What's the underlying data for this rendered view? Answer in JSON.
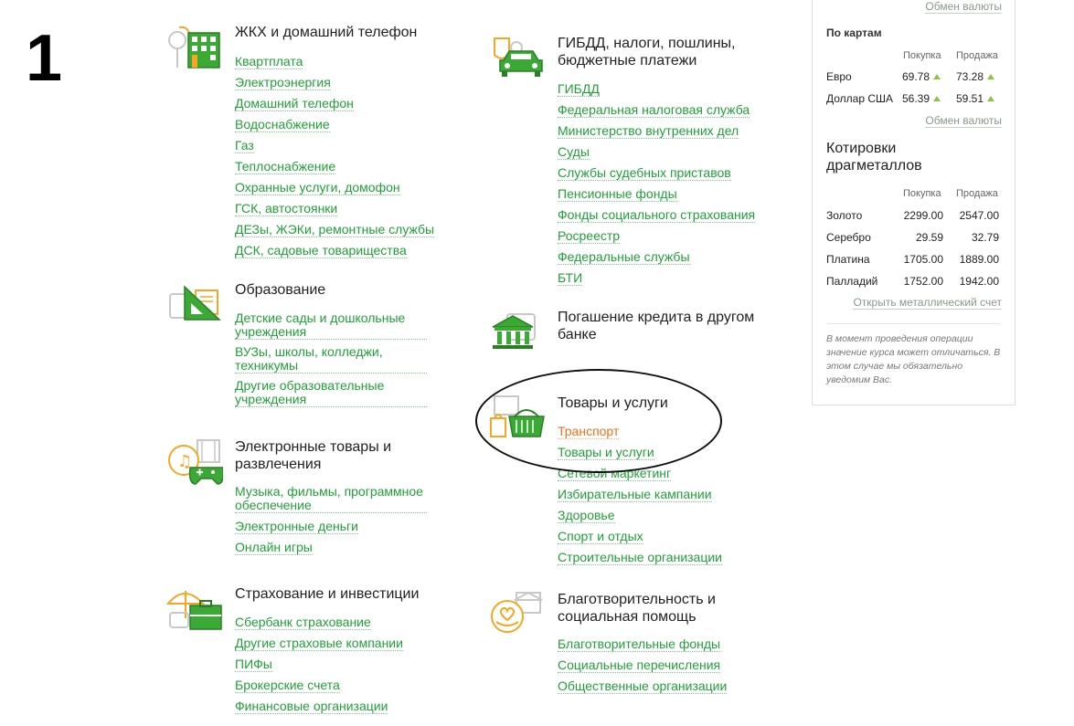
{
  "step_number": "1",
  "categories": {
    "zhkh": {
      "title": "ЖКХ и домашний телефон",
      "links": [
        "Квартплата",
        "Электроэнергия",
        "Домашний телефон",
        "Водоснабжение",
        "Газ",
        "Теплоснабжение",
        "Охранные услуги, домофон",
        "ГСК, автостоянки",
        "ДЕЗы, ЖЭКи, ремонтные службы",
        "ДСК, садовые товарищества"
      ]
    },
    "education": {
      "title": "Образование",
      "links": [
        "Детские сады и дошкольные учреждения",
        "ВУЗы, школы, колледжи, техникумы",
        "Другие образовательные учреждения"
      ]
    },
    "entertainment": {
      "title": "Электронные товары и развлечения",
      "links": [
        "Музыка, фильмы, программное обеспечение",
        "Электронные деньги",
        "Онлайн игры"
      ]
    },
    "insurance": {
      "title": "Страхование и инвестиции",
      "links": [
        "Сбербанк страхование",
        "Другие страховые компании",
        "ПИФы",
        "Брокерские счета",
        "Финансовые организации"
      ]
    },
    "gibdd": {
      "title": "ГИБДД, налоги, пошлины, бюджетные платежи",
      "links": [
        "ГИБДД",
        "Федеральная налоговая служба",
        "Министерство внутренних дел",
        "Суды",
        "Службы судебных приставов",
        "Пенсионные фонды",
        "Фонды социального страхования",
        "Росреестр",
        "Федеральные службы",
        "БТИ"
      ]
    },
    "credit": {
      "title": "Погашение кредита в другом банке",
      "links": []
    },
    "goods": {
      "title": "Товары и услуги",
      "links": [
        "Транспорт",
        "Товары и услуги",
        "Сетевой маркетинг",
        "Избирательные кампании",
        "Здоровье",
        "Спорт и отдых",
        "Строительные организации"
      ]
    },
    "charity": {
      "title": "Благотворительность и социальная помощь",
      "links": [
        "Благотворительные фонды",
        "Социальные перечисления",
        "Общественные организации"
      ]
    }
  },
  "rates": {
    "exchange_link_top": "Обмен валюты",
    "cards_label": "По картам",
    "buy_label": "Покупка",
    "sell_label": "Продажа",
    "currency_rows": [
      {
        "name": "Евро",
        "buy": "69.78",
        "sell": "73.28"
      },
      {
        "name": "Доллар США",
        "buy": "56.39",
        "sell": "59.51"
      }
    ],
    "exchange_link": "Обмен валюты",
    "metals_title": "Котировки драгметаллов",
    "metal_rows": [
      {
        "name": "Золото",
        "buy": "2299.00",
        "sell": "2547.00"
      },
      {
        "name": "Серебро",
        "buy": "29.59",
        "sell": "32.79"
      },
      {
        "name": "Платина",
        "buy": "1705.00",
        "sell": "1889.00"
      },
      {
        "name": "Палладий",
        "buy": "1752.00",
        "sell": "1942.00"
      }
    ],
    "metal_account_link": "Открыть металлический счет",
    "note": "В момент проведения операции значение курса может отличаться. В этом случае мы обязательно уведомим Вас."
  },
  "colors": {
    "link": "#21a038",
    "active_link": "#e8731c",
    "icon_green": "#3aaa35",
    "icon_orange": "#f5a623",
    "icon_gray": "#c8c8c8"
  }
}
